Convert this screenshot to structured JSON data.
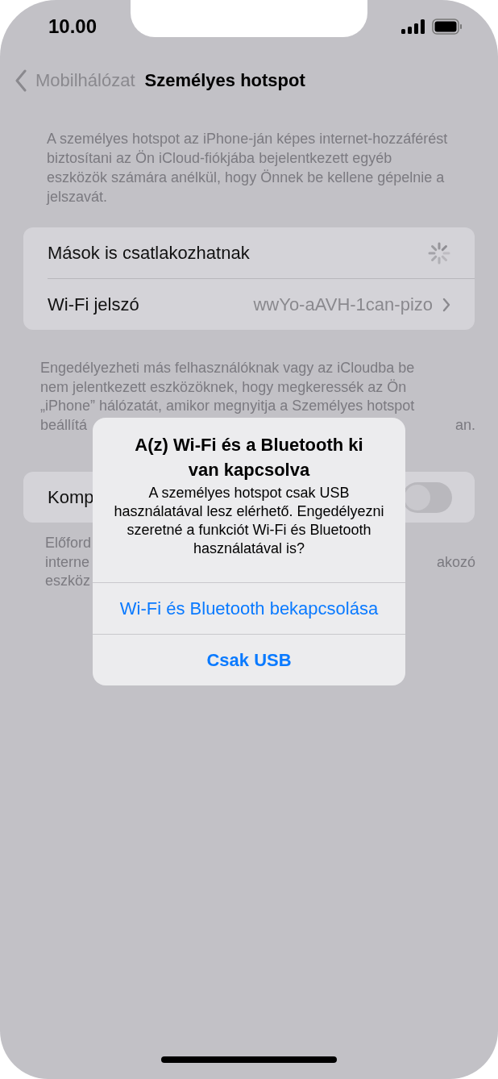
{
  "status_bar": {
    "time": "10.00"
  },
  "nav": {
    "back": "Mobilhálózat",
    "title": "Személyes hotspot"
  },
  "header_text": "A személyes hotspot az iPhone-ján képes internet-hozzáférést biztosítani az Ön iCloud-fiókjába bejelentkezett egyéb eszközök számára anélkül, hogy Önnek be kellene gépelnie a jelszavát.",
  "settings": [
    {
      "kind": "spinner",
      "label": "Mások is csatlakozhatnak"
    },
    {
      "kind": "link",
      "label": "Wi-Fi jelszó",
      "value": "wwYo-aAVH-1can-pizo"
    }
  ],
  "settings_footer": [
    {
      "left": "Engedélyezheti más felhasználóknak vagy az iCloudba be"
    },
    {
      "left": "nem jelentkezett eszközöknek, hogy megkeressék az Ön"
    },
    {
      "left": "„iPhone” hálózatát, amikor megnyitja a Személyes hotspot"
    },
    {
      "left": "beállítá",
      "right": "an."
    }
  ],
  "compat_row": {
    "label": "Komp",
    "on": false
  },
  "compat_footer": [
    {
      "left": "Előford"
    },
    {
      "left": "interne",
      "right": "akozó"
    },
    {
      "left": "eszköz"
    }
  ],
  "alert": {
    "title": "A(z) Wi-Fi és a Bluetooth ki van kapcsolva",
    "message": "A személyes hotspot csak USB használatával lesz elérhető. Engedélyezni szeretné a funkciót Wi-Fi és Bluetooth használatával is?",
    "buttons": [
      {
        "label": "Wi-Fi és Bluetooth bekapcsolása",
        "kind": "default"
      },
      {
        "label": "Csak USB",
        "kind": "preferred"
      }
    ]
  }
}
